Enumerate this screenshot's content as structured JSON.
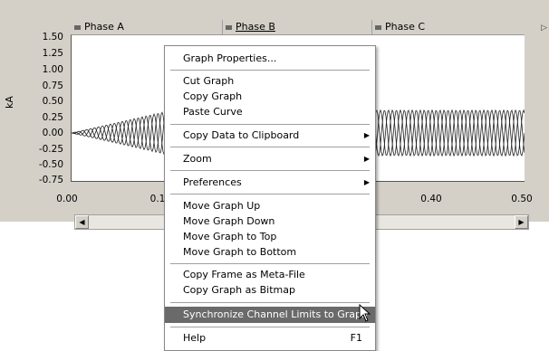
{
  "headers": {
    "phase_a": "Phase A",
    "phase_b": "Phase B",
    "phase_c": "Phase C"
  },
  "axis": {
    "ylabel": "kA",
    "yticks": [
      "1.50",
      "1.25",
      "1.00",
      "0.75",
      "0.50",
      "0.25",
      "0.00",
      "-0.25",
      "-0.50",
      "-0.75"
    ],
    "xticks": [
      "0.00",
      "0.1",
      "0.40",
      "0.50"
    ]
  },
  "menu": {
    "graph_properties": "Graph Properties...",
    "cut_graph": "Cut Graph",
    "copy_graph": "Copy Graph",
    "paste_curve": "Paste Curve",
    "copy_data": "Copy Data to Clipboard",
    "zoom": "Zoom",
    "preferences": "Preferences",
    "move_up": "Move Graph Up",
    "move_down": "Move Graph Down",
    "move_top": "Move Graph to Top",
    "move_bottom": "Move Graph to Bottom",
    "copy_frame": "Copy Frame as Meta-File",
    "copy_bitmap": "Copy Graph as Bitmap",
    "sync_limits": "Synchronize Channel Limits to Graph",
    "help": "Help",
    "help_shortcut": "F1"
  },
  "colors": {
    "menu_highlight": "#6a6a6a",
    "frame": "#d4d0c8"
  }
}
